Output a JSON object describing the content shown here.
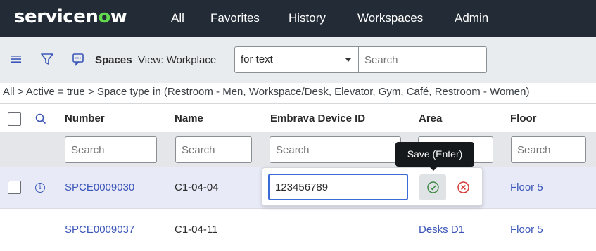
{
  "app": {
    "logo_main": "servicen",
    "logo_o": "o",
    "logo_end": "w"
  },
  "nav": {
    "items": [
      "All",
      "Favorites",
      "History",
      "Workspaces",
      "Admin"
    ]
  },
  "toolbar": {
    "menu_icon": "hamburger-menu-icon",
    "filter_icon": "funnel-filter-icon",
    "context_icon": "context-menu-icon",
    "title": "Spaces",
    "view_label": "View: Workplace",
    "search_field_selected": "for text",
    "search_placeholder": "Search"
  },
  "breadcrumb": "All > Active = true > Space type in (Restroom - Men, Workspace/Desk, Elevator, Gym, Café, Restroom - Women)",
  "table": {
    "columns": [
      "Number",
      "Name",
      "Embrava Device ID",
      "Area",
      "Floor"
    ],
    "filter_placeholder": "Search",
    "rows": [
      {
        "number": "SPCE0009030",
        "name": "C1-04-04",
        "device_id": "",
        "area": "",
        "floor": "Floor 5"
      },
      {
        "number": "SPCE0009037",
        "name": "C1-04-11",
        "device_id": "",
        "area": "Desks D1",
        "floor": "Floor 5"
      }
    ]
  },
  "editor": {
    "value": "123456789",
    "save_tooltip": "Save (Enter)",
    "save_icon": "check-circle-icon",
    "cancel_icon": "x-circle-icon"
  },
  "colors": {
    "nav_bg": "#222b36",
    "accent_green": "#62d84e",
    "link": "#3b56b8",
    "selected_row": "#e8ebf7",
    "editor_border": "#3b6bd6"
  }
}
